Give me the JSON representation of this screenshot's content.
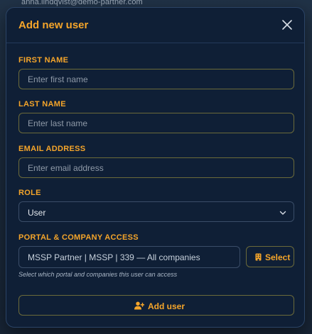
{
  "background": {
    "user_email": "anna.lindqvist@demo-partner.com"
  },
  "modal": {
    "title": "Add new user",
    "close_icon": "close-icon"
  },
  "form": {
    "first_name": {
      "label": "FIRST NAME",
      "value": "",
      "placeholder": "Enter first name"
    },
    "last_name": {
      "label": "LAST NAME",
      "value": "",
      "placeholder": "Enter last name"
    },
    "email": {
      "label": "EMAIL ADDRESS",
      "value": "",
      "placeholder": "Enter email address"
    },
    "role": {
      "label": "ROLE",
      "selected": "User",
      "icon": "chevron-down-icon"
    },
    "portal": {
      "label": "PORTAL & COMPANY ACCESS",
      "value": "MSSP Partner | MSSP | 339 — All companies",
      "select_label": "Select",
      "select_icon": "building-icon",
      "helper": "Select which portal and companies this user can access"
    }
  },
  "actions": {
    "add_user_label": "Add user",
    "add_user_icon": "user-plus-icon"
  },
  "colors": {
    "accent": "#f5a52a",
    "modal_bg": "#0f1f36",
    "border": "#6b6a3a"
  }
}
